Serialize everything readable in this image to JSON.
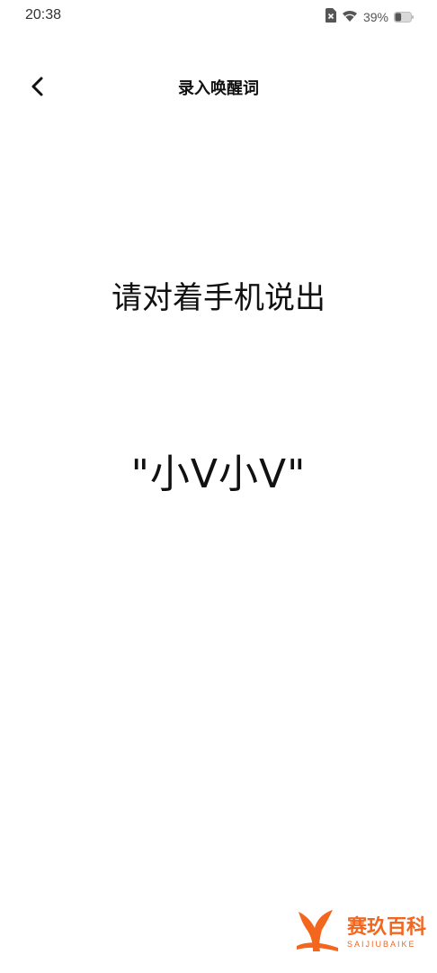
{
  "status_bar": {
    "time": "20:38",
    "battery_percent_text": "39%",
    "battery_level": 0.39,
    "icons": [
      "sim-off-icon",
      "wifi-icon",
      "battery-icon"
    ]
  },
  "header": {
    "title": "录入唤醒词",
    "back_icon": "chevron-left-icon"
  },
  "main": {
    "instruction": "请对着手机说出",
    "wake_word": "\"小V小V\""
  },
  "watermark": {
    "name_cn": "赛玖百科",
    "name_en": "SAIJIUBAIKE",
    "color": "#f2661e"
  }
}
